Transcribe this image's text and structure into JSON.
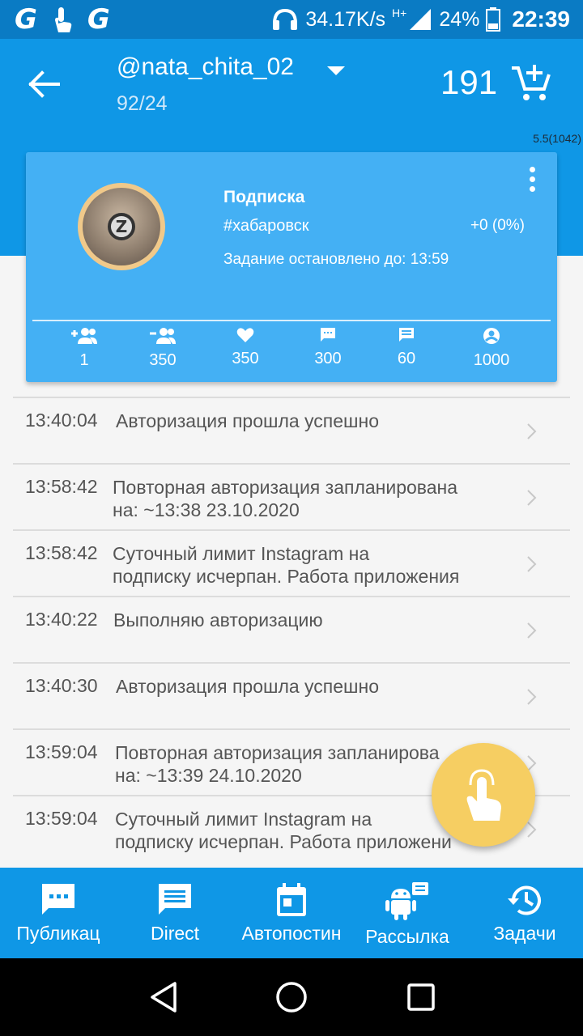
{
  "status_bar": {
    "left_icons": [
      "G",
      "G"
    ],
    "speed": "34.17K/s",
    "network": "H+",
    "battery": "24%",
    "time": "22:39"
  },
  "app_bar": {
    "account": "@nata_chita_02",
    "subtitle": "92/24",
    "coins": "191"
  },
  "version": "5.5(1042)",
  "card": {
    "title": "Подписка",
    "tag": "#хабаровск",
    "delta": "+0 (0%)",
    "status": "Задание остановлено до: 13:59",
    "stats": [
      {
        "icon": "person-add-icon",
        "value": "1"
      },
      {
        "icon": "person-remove-icon",
        "value": "350"
      },
      {
        "icon": "heart-icon",
        "value": "350"
      },
      {
        "icon": "comment-icon",
        "value": "300"
      },
      {
        "icon": "message-icon",
        "value": "60"
      },
      {
        "icon": "account-circle-icon",
        "value": "1000"
      }
    ]
  },
  "log": [
    {
      "time": "13:40:04",
      "line1": "Авторизация прошла успешно",
      "line2": ""
    },
    {
      "time": "13:58:42",
      "line1": "Повторная авторизация запланирована",
      "line2": "на: ~13:38 23.10.2020"
    },
    {
      "time": "13:58:42",
      "line1": "Суточный лимит Instagram на",
      "line2": "подписку исчерпан. Работа приложения"
    },
    {
      "time": "13:40:22",
      "line1": "Выполняю авторизацию",
      "line2": ""
    },
    {
      "time": "13:40:30",
      "line1": "Авторизация прошла успешно",
      "line2": ""
    },
    {
      "time": "13:59:04",
      "line1": "Повторная авторизация запланирова",
      "line2": "на: ~13:39 24.10.2020"
    },
    {
      "time": "13:59:04",
      "line1": "Суточный лимит Instagram на",
      "line2": "подписку исчерпан. Работа приложени"
    }
  ],
  "bottom_nav": [
    {
      "label": "Публикац",
      "icon": "chat-dots-icon"
    },
    {
      "label": "Direct",
      "icon": "message-icon"
    },
    {
      "label": "Автопостин",
      "icon": "calendar-icon"
    },
    {
      "label": "Рассылка",
      "icon": "android-icon"
    },
    {
      "label": "Задачи",
      "icon": "history-icon"
    }
  ],
  "colors": {
    "primary": "#0f97e6",
    "status_bar": "#0a7bc4",
    "card": "#44b0f4",
    "fab": "#f6ce62"
  }
}
